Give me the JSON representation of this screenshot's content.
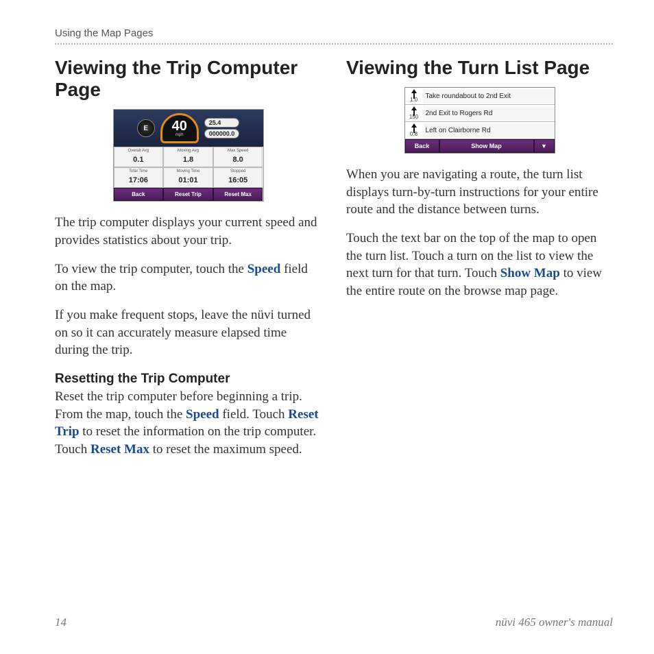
{
  "header": {
    "section": "Using the Map Pages"
  },
  "left": {
    "title": "Viewing the Trip Computer Page",
    "trip_shot": {
      "compass_dir": "E",
      "speed": "40",
      "speed_unit": "mph",
      "dist": "25.4",
      "odo": "000000.0",
      "cells": [
        {
          "label": "Overall Avg",
          "value": "0.1"
        },
        {
          "label": "Moving Avg",
          "value": "1.8"
        },
        {
          "label": "Max Speed",
          "value": "8.0"
        },
        {
          "label": "Total Time",
          "value": "17:06"
        },
        {
          "label": "Moving Time",
          "value": "01:01"
        },
        {
          "label": "Stopped",
          "value": "16:05"
        }
      ],
      "buttons": {
        "back": "Back",
        "reset_trip": "Reset Trip",
        "reset_max": "Reset Max"
      }
    },
    "p1": "The trip computer displays your current speed and provides statistics about your trip.",
    "p2_a": "To view the trip computer, touch the ",
    "p2_b": "Speed",
    "p2_c": " field on the map.",
    "p3": "If you make frequent stops, leave the nüvi turned on so it can accurately measure elapsed time during the trip.",
    "sub": "Resetting the Trip Computer",
    "p4_a": "Reset the trip computer before beginning a trip. From the map, touch the ",
    "p4_b": "Speed",
    "p4_c": " field. Touch ",
    "p4_d": "Reset Trip",
    "p4_e": " to reset the information on the trip computer. Touch ",
    "p4_f": "Reset Max",
    "p4_g": " to reset the maximum speed."
  },
  "right": {
    "title": "Viewing the Turn List Page",
    "turn_shot": {
      "rows": [
        {
          "dist": "1.0",
          "text": "Take roundabout to 2nd Exit"
        },
        {
          "dist": "150",
          "text": "2nd Exit to Rogers Rd"
        },
        {
          "dist": "0.8",
          "text": "Left on Clairborne Rd"
        }
      ],
      "buttons": {
        "back": "Back",
        "show_map": "Show Map"
      }
    },
    "p1": "When you are navigating a route, the turn list displays turn-by-turn instructions for your entire route and the distance between turns.",
    "p2_a": "Touch the text bar on the top of the map to open the turn list. Touch a turn on the list to view the next turn for that turn. Touch ",
    "p2_b": "Show Map",
    "p2_c": " to view the entire route on the browse map page."
  },
  "footer": {
    "page": "14",
    "manual": "nüvi 465 owner's manual"
  }
}
